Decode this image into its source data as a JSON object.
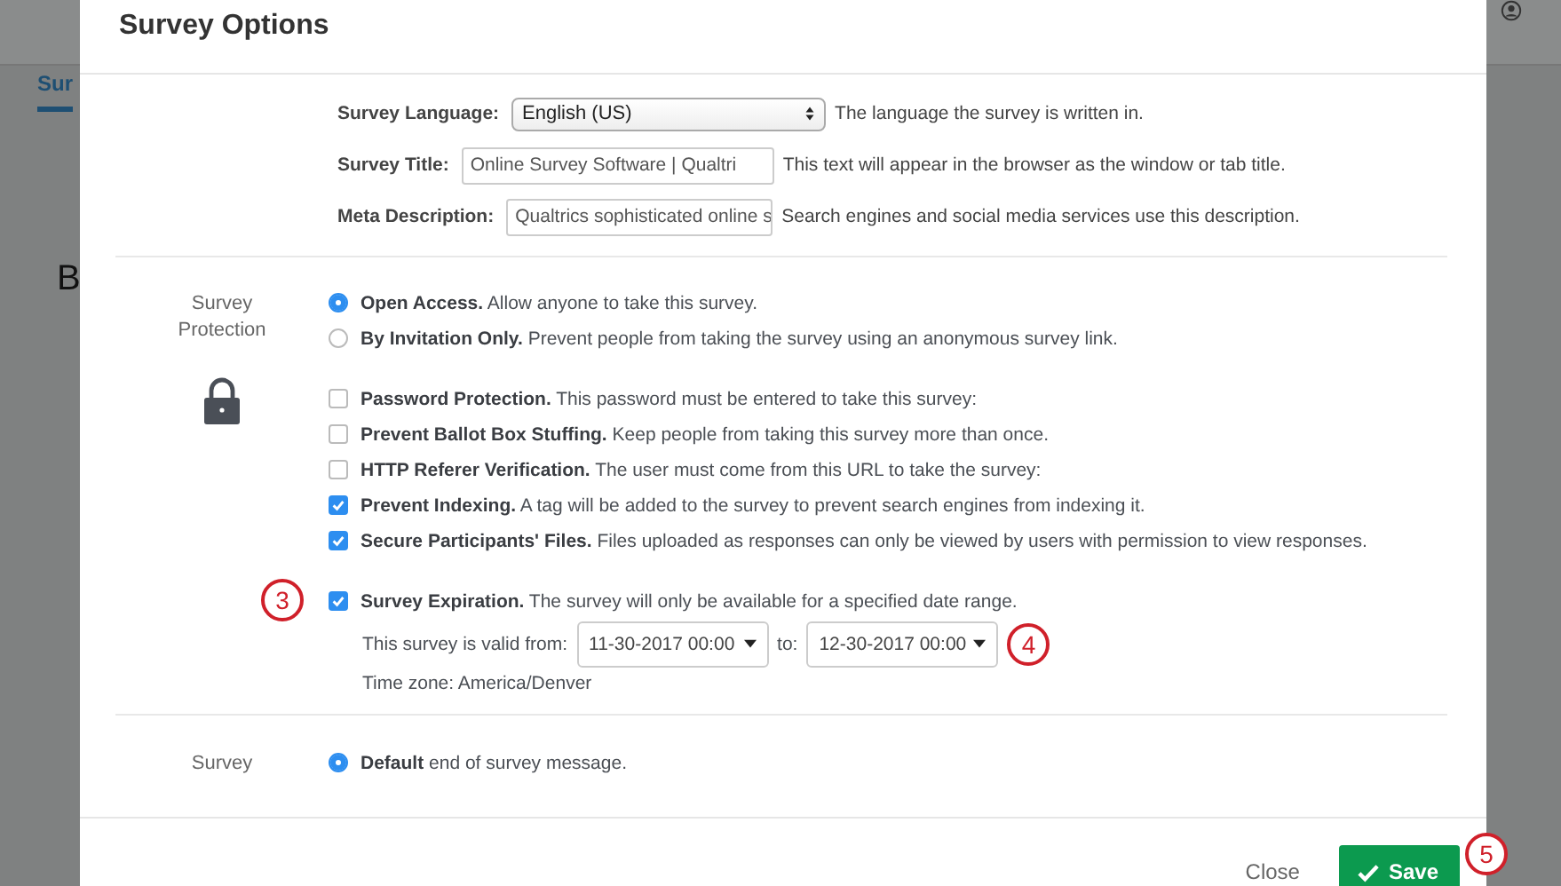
{
  "background": {
    "tab": "Sur",
    "heading": "B"
  },
  "dialog": {
    "title": "Survey Options"
  },
  "general_fields": [
    {
      "kind": "select",
      "label": "Survey Language:",
      "value": "English (US)",
      "help": "The language the survey is written in."
    },
    {
      "kind": "text",
      "label": "Survey Title:",
      "value": "Online Survey Software | Qualtri",
      "help": "This text will appear in the browser as the window or tab title."
    },
    {
      "kind": "text",
      "label": "Meta Description:",
      "value": "Qualtrics sophisticated online s",
      "help": "Search engines and social media services use this description."
    }
  ],
  "protection": {
    "label": "Survey Protection",
    "access_options": [
      {
        "text": "**Open Access.** Allow anyone to take this survey.",
        "selected": true
      },
      {
        "text": "**By Invitation Only.** Prevent people from taking the survey using an anonymous survey link.",
        "selected": false
      }
    ],
    "options": [
      {
        "text": "**Password Protection.** This password must be entered to take this survey:",
        "checked": false
      },
      {
        "text": "**Prevent Ballot Box Stuffing.** Keep people from taking this survey more than once.",
        "checked": false
      },
      {
        "text": "**HTTP Referer Verification.** The user must come from this URL to take the survey:",
        "checked": false
      },
      {
        "text": "**Prevent Indexing.** A tag will be added to the survey to prevent search engines from indexing it.",
        "checked": true
      },
      {
        "text": "**Secure Participants' Files.** Files uploaded as responses can only be viewed by users with permission to view responses.",
        "checked": true
      }
    ],
    "expiration": {
      "text": "**Survey Expiration.** The survey will only be available for a specified date range.",
      "checked": true,
      "callout": "3",
      "valid_from_label": "This survey is valid from:",
      "from": "11-30-2017 00:00",
      "to_label": "to:",
      "to": "12-30-2017 00:00",
      "date_callout": "4",
      "time_zone": "Time zone: America/Denver"
    }
  },
  "end_of_survey": {
    "label": "Survey",
    "options": [
      {
        "text": "**Default** end of survey message.",
        "selected": true
      }
    ]
  },
  "footer": {
    "close": "Close",
    "save": "Save",
    "save_callout": "5"
  }
}
